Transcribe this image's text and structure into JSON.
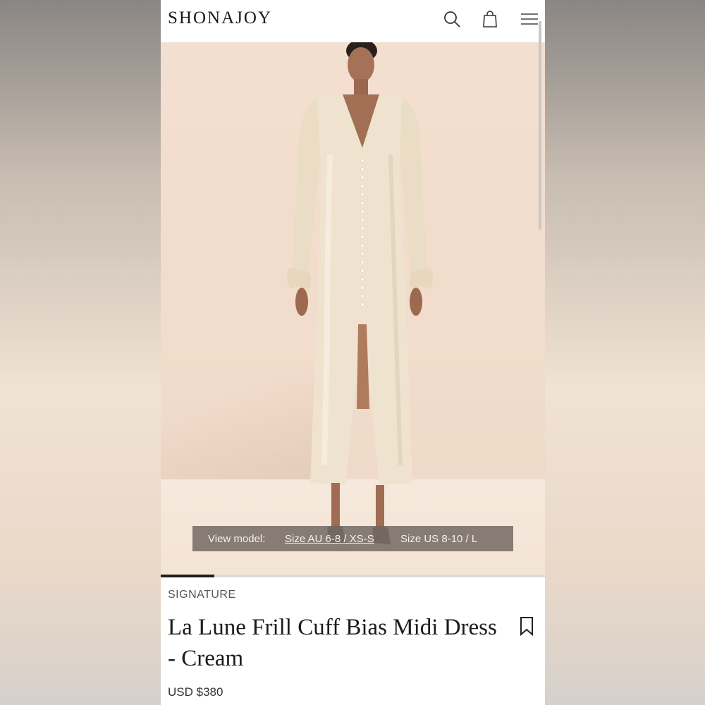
{
  "brand": {
    "logo": "SHONAJOY"
  },
  "header": {
    "icons": [
      "search-icon",
      "bag-icon",
      "menu-icon"
    ]
  },
  "hero": {
    "view_model": {
      "label": "View model:",
      "size_options": [
        "Size AU 6-8 / XS-S",
        "Size US 8-10 / L"
      ],
      "selected": "Size AU 6-8 / XS-S"
    },
    "gallery_progress": 0.14
  },
  "product": {
    "collection": "SIGNATURE",
    "title": "La Lune Frill Cuff Bias Midi Dress - Cream",
    "price": "USD $380",
    "bookmark_icon": "bookmark-icon"
  },
  "colors": {
    "text": "#1b1b1b",
    "dress": "#efe3cf",
    "backdrop": "#f2dccb",
    "overlay": "#6e645f"
  }
}
